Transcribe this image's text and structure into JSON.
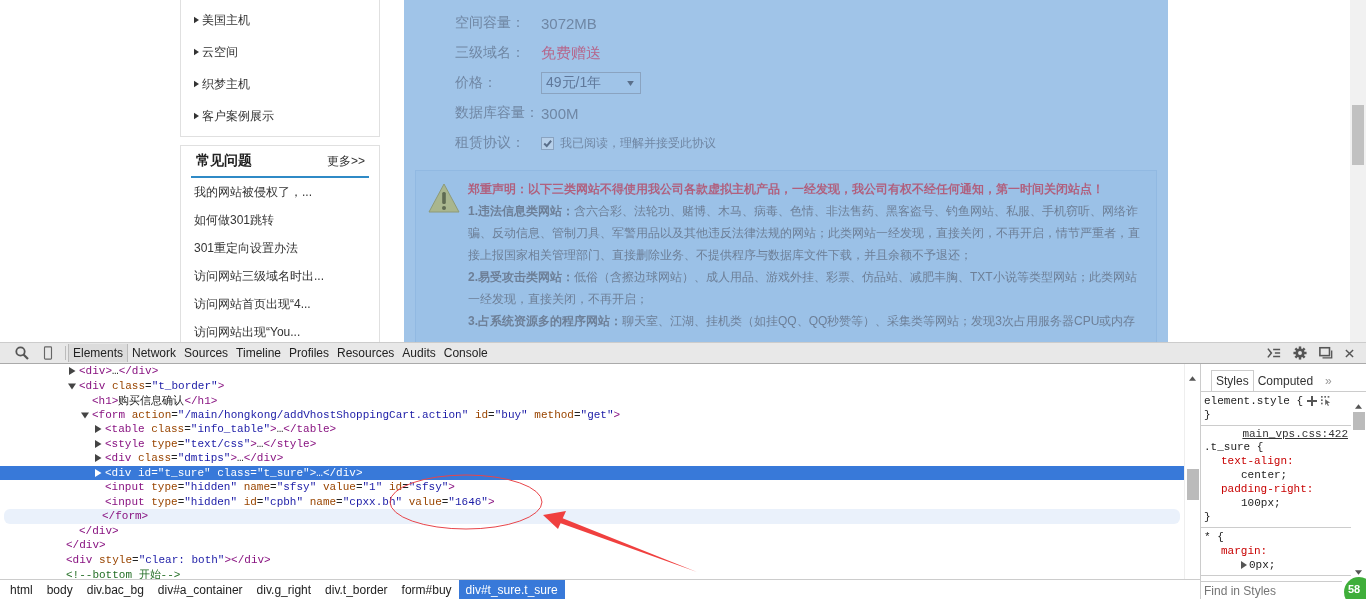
{
  "page": {
    "sidebar_menu": [
      "美国主机",
      "云空间",
      "织梦主机",
      "客户案例展示"
    ],
    "faq": {
      "title": "常见问题",
      "more": "更多>>",
      "items": [
        "我的网站被侵权了，...",
        "如何做301跳转",
        "301重定向设置办法",
        "访问网站三级域名时出...",
        "访问网站首页出现“4...",
        "访问网站出现“You..."
      ]
    },
    "product": {
      "inspect_highlight": true,
      "rows": [
        {
          "kind": "text",
          "label": "空间容量：",
          "value": "3072MB"
        },
        {
          "kind": "highlight",
          "label": "三级域名：",
          "value": "免费赠送"
        },
        {
          "kind": "select",
          "label": "价格：",
          "value": "49元/1年"
        },
        {
          "kind": "text",
          "label": "数据库容量：",
          "value": "300M"
        },
        {
          "kind": "checkbox",
          "label": "租赁协议：",
          "value": "我已阅读，理解并接受此协议",
          "checked": true
        }
      ],
      "notice": {
        "heading": "郑重声明：以下三类网站不得使用我公司各款虚拟主机产品，一经发现，我公司有权不经任何通知，第一时间关闭站点！",
        "paragraphs": [
          "**1.违法信息类网站：**含六合彩、法轮功、赌博、木马、病毒、色情、非法售药、黑客盗号、钓鱼网站、私服、手机窃听、网络诈骗、反动信息、管制刀具、军警用品以及其他违反法律法规的网站；此类网站一经发现，直接关闭，不再开启，情节严重者，直接上报国家相关管理部门、直接删除业务、不提供程序与数据库文件下载，并且余额不予退还；",
          "**2.易受攻击类网站：**低俗（含擦边球网站）、成人用品、游戏外挂、彩票、仿品站、减肥丰胸、TXT小说等类型网站；此类网站一经发现，直接关闭，不再开启；",
          "**3.占系统资源多的程序网站：**聊天室、江湖、挂机类（如挂QQ、QQ秒赞等）、采集类等网站；发现3次占用服务器CPU或内存"
        ]
      }
    }
  },
  "devtools": {
    "tabs": [
      {
        "label": "Elements",
        "selected": true
      },
      {
        "label": "Network",
        "selected": false
      },
      {
        "label": "Sources",
        "selected": false
      },
      {
        "label": "Timeline",
        "selected": false
      },
      {
        "label": "Profiles",
        "selected": false
      },
      {
        "label": "Resources",
        "selected": false
      },
      {
        "label": "Audits",
        "selected": false
      },
      {
        "label": "Console",
        "selected": false
      }
    ],
    "dom_tree": [
      {
        "closing": "</div>",
        "children": [
          {
            "text": "<div>…</div>",
            "expanded": false,
            "selected": false
          },
          {
            "text": "<div class=\"t_border\">",
            "expanded": true,
            "selected": false,
            "closing": "</div>",
            "children": [
              {
                "text": "<h1>购买信息确认</h1>",
                "selected": false
              },
              {
                "text": "<form action=\"/main/hongkong/addVhostShoppingCart.action\" id=\"buy\" method=\"get\">",
                "expanded": true,
                "selected": false,
                "hovered": true,
                "closing": "</form>",
                "children": [
                  {
                    "text": "<table class=\"info_table\">…</table>",
                    "expanded": false,
                    "selected": false
                  },
                  {
                    "text": "<style type=\"text/css\">…</style>",
                    "expanded": false,
                    "selected": false
                  },
                  {
                    "text": "<div class=\"dmtips\">…</div>",
                    "expanded": false,
                    "selected": false
                  },
                  {
                    "text": "<div id=\"t_sure\" class=\"t_sure\">…</div>",
                    "expanded": false,
                    "selected": true
                  },
                  {
                    "text": "<input type=\"hidden\" name=\"sfsy\" value=\"1\" id=\"sfsy\">",
                    "selected": false
                  },
                  {
                    "text": "<input type=\"hidden\" id=\"cpbh\" name=\"cpxx.bh\" value=\"1646\">",
                    "selected": false
                  }
                ]
              }
            ]
          }
        ]
      },
      {
        "text": "<div style=\"clear: both\"></div>",
        "selected": false
      },
      {
        "text": "<!--bottom 开始-->",
        "selected": false
      }
    ],
    "breadcrumbs": [
      {
        "label": "html",
        "selected": false
      },
      {
        "label": "body",
        "selected": false
      },
      {
        "label": "div.bac_bg",
        "selected": false
      },
      {
        "label": "div#a_container",
        "selected": false
      },
      {
        "label": "div.g_right",
        "selected": false
      },
      {
        "label": "div.t_border",
        "selected": false
      },
      {
        "label": "form#buy",
        "selected": false
      },
      {
        "label": "div#t_sure.t_sure",
        "selected": true
      }
    ],
    "styles": {
      "tabs": [
        {
          "label": "Styles",
          "selected": true
        },
        {
          "label": "Computed",
          "selected": false
        }
      ],
      "more": "»",
      "rules": [
        {
          "kind": "inline",
          "selector": "element.style {",
          "closing": "}"
        },
        {
          "kind": "rule",
          "source": "main_vps.css:422",
          "selector": ".t_sure {",
          "closing": "}",
          "properties": [
            {
              "name": "text-align:",
              "value": "center;"
            },
            {
              "name": "padding-right:",
              "value": "100px;"
            }
          ]
        },
        {
          "kind": "rule",
          "selector": "* {",
          "properties": [
            {
              "name": "margin:",
              "value": "0px;",
              "expandable": true
            }
          ]
        }
      ],
      "filter_placeholder": "Find in Styles"
    }
  },
  "badge": "58"
}
